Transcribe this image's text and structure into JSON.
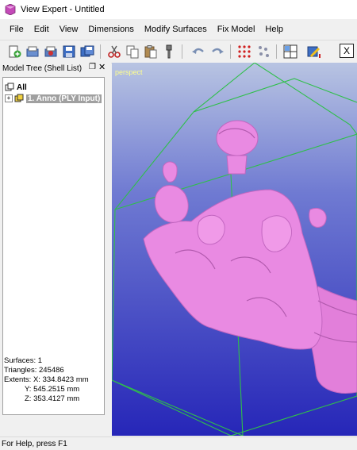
{
  "window": {
    "title": "View Expert - Untitled"
  },
  "menu": [
    "File",
    "Edit",
    "View",
    "Dimensions",
    "Modify Surfaces",
    "Fix Model",
    "Help"
  ],
  "toolbar": {
    "buttons": [
      "new-icon",
      "open-icon",
      "import-icon",
      "save-icon",
      "save-all-icon",
      "cut-icon",
      "copy-icon",
      "paste-icon",
      "fix-icon",
      "undo-icon",
      "redo-icon",
      "points-grid-icon",
      "points-scatter-icon",
      "view-layout-icon",
      "edit-pencil-icon",
      "close-x-icon"
    ],
    "close_label": "X"
  },
  "model_tree": {
    "title": "Model Tree (Shell List)",
    "pin": "❐",
    "close": "✕",
    "root_label": "All",
    "items": [
      {
        "label": "1. Anno (PLY Input)",
        "selected": true
      }
    ]
  },
  "stats": {
    "surfaces": "Surfaces: 1",
    "triangles": "Triangles: 245486",
    "extents_x": "Extents:  X: 334.8423 mm",
    "extents_y": "Y: 545.2515 mm",
    "extents_z": "Z: 353.4127 mm"
  },
  "viewport": {
    "label": "perspect"
  },
  "colors": {
    "model": "#e98ae2",
    "bbox": "#2fbf4a",
    "vp_top": "#b8c4e2",
    "vp_bottom": "#2626b8"
  },
  "status": {
    "text": "For Help, press F1"
  }
}
